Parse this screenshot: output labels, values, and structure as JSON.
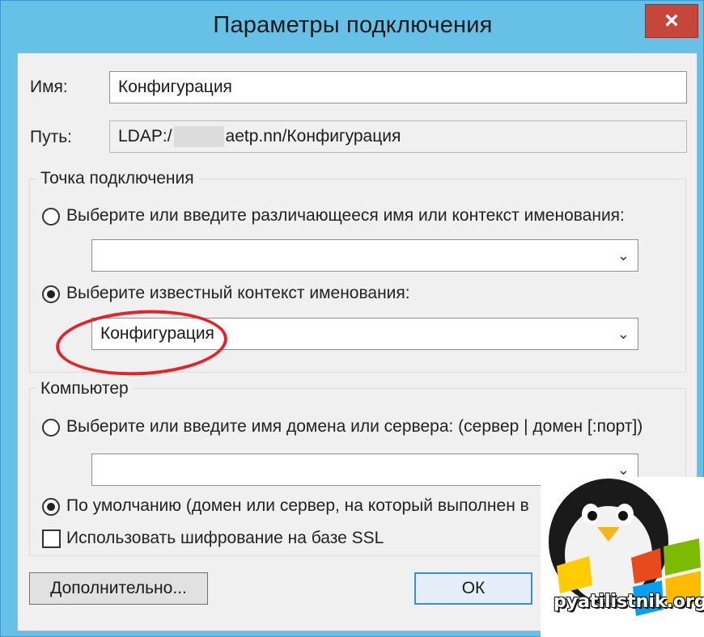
{
  "window": {
    "title": "Параметры подключения",
    "close_label": "×"
  },
  "fields": {
    "name_label": "Имя:",
    "name_value": "Конфигурация",
    "path_label": "Путь:",
    "path_prefix": "LDAP:/",
    "path_suffix": "aetp.nn/Конфигурация"
  },
  "connection_point": {
    "title": "Точка подключения",
    "option_dn_label": "Выберите или введите различающееся имя или контекст именования:",
    "option_dn_selected": false,
    "dn_combo_value": "",
    "option_known_label": "Выберите известный контекст именования:",
    "option_known_selected": true,
    "known_combo_value": "Конфигурация"
  },
  "computer": {
    "title": "Компьютер",
    "option_server_label": "Выберите или введите имя домена или сервера: (сервер | домен [:порт])",
    "option_server_selected": false,
    "server_combo_value": "",
    "option_default_label": "По умолчанию (домен или сервер, на который выполнен в",
    "option_default_selected": true,
    "ssl_label": "Использовать шифрование на базе SSL",
    "ssl_checked": false
  },
  "buttons": {
    "advanced": "Дополнительно...",
    "ok": "ОК"
  },
  "watermark": {
    "text": "pyatilistnik.org"
  },
  "icons": {
    "chevron": "chevron-down-icon",
    "logo": "penguin-logo-icon"
  },
  "colors": {
    "title_bar": "#67c0e6",
    "close": "#c7463b",
    "highlight": "#e2242a"
  }
}
